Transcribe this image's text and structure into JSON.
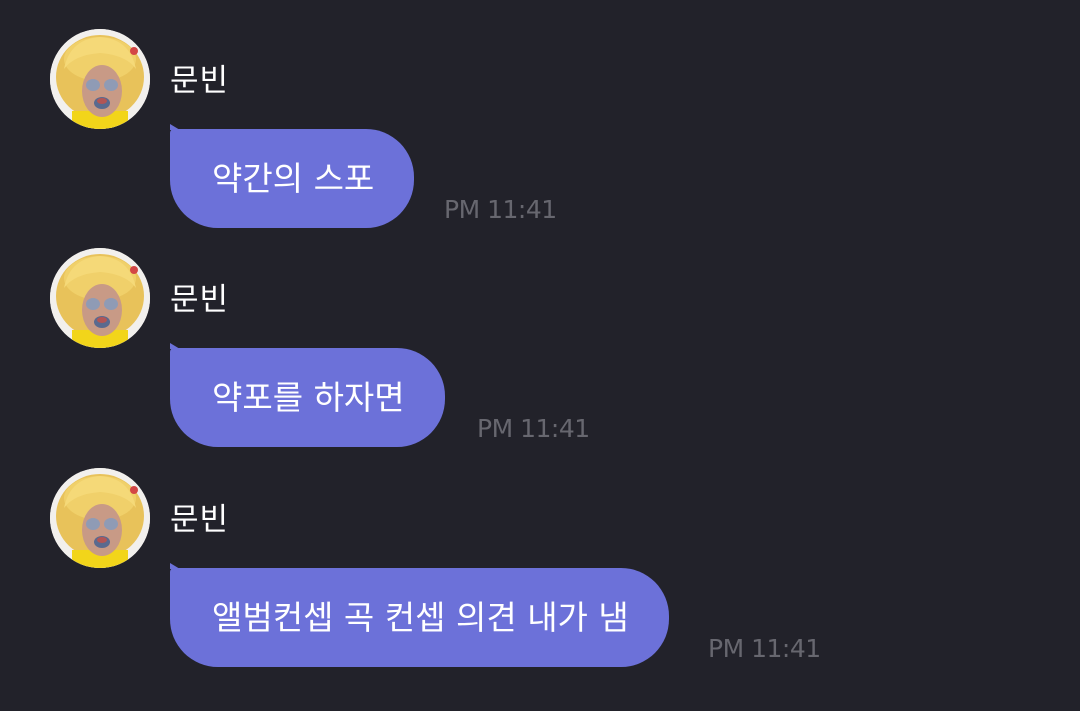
{
  "messages": [
    {
      "sender": "문빈",
      "text": "약간의 스포",
      "time": "PM 11:41"
    },
    {
      "sender": "문빈",
      "text": "약포를 하자면",
      "time": "PM 11:41"
    },
    {
      "sender": "문빈",
      "text": "앨범컨셉 곡 컨셉 의견 내가 냄",
      "time": "PM 11:41"
    }
  ],
  "colors": {
    "background": "#22222a",
    "bubble": "#6c71d9",
    "timestamp": "#67676f"
  }
}
